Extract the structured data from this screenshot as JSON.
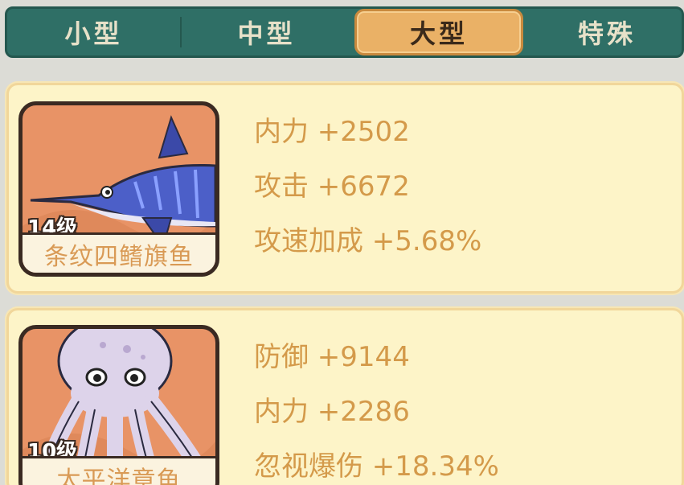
{
  "tabs": [
    {
      "label": "小型"
    },
    {
      "label": "中型"
    },
    {
      "label": "大型",
      "active": true
    },
    {
      "label": "特殊"
    }
  ],
  "cards": [
    {
      "level": "14级",
      "name": "条纹四鳍旗鱼",
      "icon": "marlin-icon",
      "stats": [
        "内力 +2502",
        "攻击 +6672",
        "攻速加成 +5.68%"
      ]
    },
    {
      "level": "10级",
      "name": "太平洋章鱼",
      "icon": "octopus-icon",
      "stats": [
        "防御 +9144",
        "内力 +2286",
        "忽视爆伤 +18.34%"
      ]
    }
  ],
  "colors": {
    "tab_bar": "#2f6f66",
    "tab_active": "#eab166",
    "card_bg": "#fdf4c8",
    "portrait_bg": "#e89366",
    "stat_text": "#d49a4a"
  }
}
